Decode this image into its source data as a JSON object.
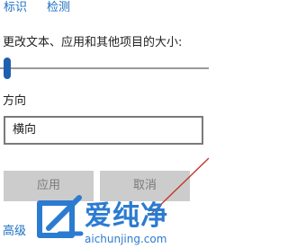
{
  "links": [
    "标识",
    "检测"
  ],
  "text_size": {
    "label": "更改文本、应用和其他项目的大小:",
    "slider_value_fraction": 0.0
  },
  "orientation": {
    "label": "方向",
    "selected": "横向"
  },
  "buttons": {
    "apply": "应用",
    "cancel": "取消"
  },
  "advanced_link": "高级",
  "watermark": {
    "text_cn": "爱纯净",
    "text_en": "aichunjing.com"
  },
  "colors": {
    "link": "#1a6fc4",
    "slider_thumb": "#1f5fb0",
    "button_disabled": "#cccccc",
    "watermark": "#2b7bd1",
    "annotation_line": "#c0392b"
  }
}
